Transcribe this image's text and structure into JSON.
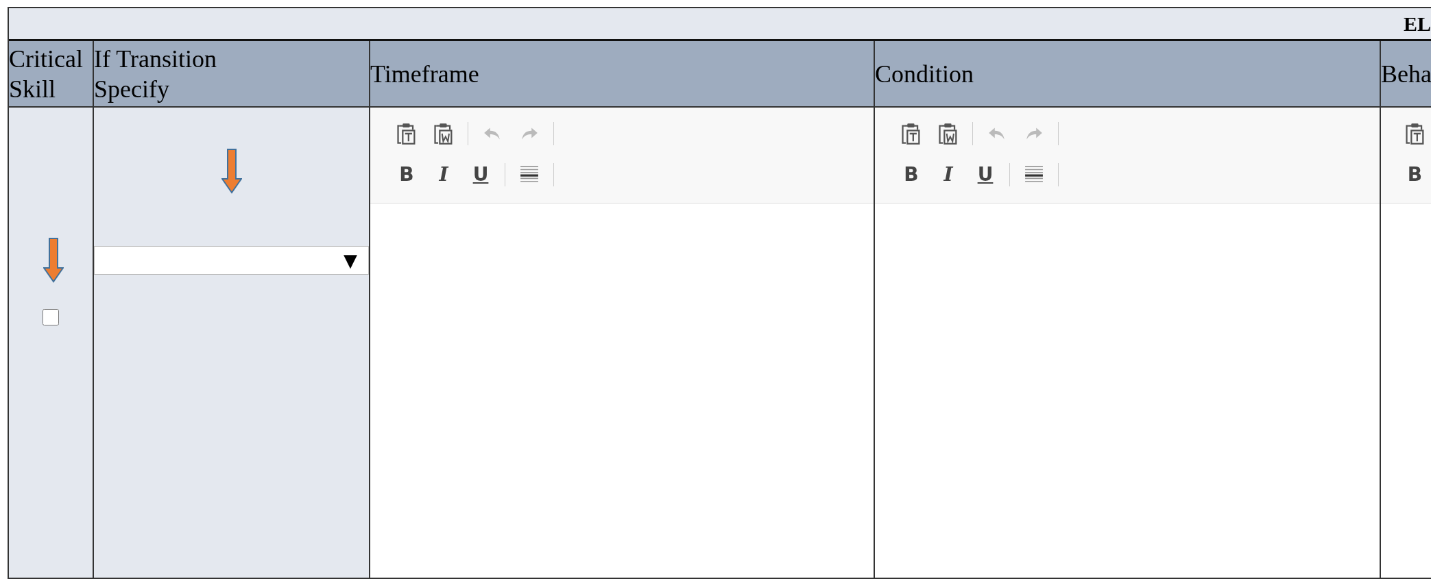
{
  "title": "EL",
  "headers": [
    "Critical Skill",
    "If Transition\nSpecify",
    "Timeframe",
    "Condition",
    "Beha"
  ],
  "critical_skill": {
    "checked": false
  },
  "transition_select": {
    "caret": "▼"
  },
  "editors": [
    {
      "rows": [
        [
          {
            "kind": "paste_text"
          },
          {
            "kind": "paste_word"
          },
          {
            "kind": "separator"
          },
          {
            "kind": "undo",
            "disabled": true
          },
          {
            "kind": "redo",
            "disabled": true
          },
          {
            "kind": "separator"
          }
        ],
        [
          {
            "kind": "bold",
            "label": "B"
          },
          {
            "kind": "italic",
            "label": "I"
          },
          {
            "kind": "underline",
            "label": "U"
          },
          {
            "kind": "separator"
          },
          {
            "kind": "rule"
          },
          {
            "kind": "separator"
          }
        ]
      ]
    },
    {
      "rows": [
        [
          {
            "kind": "paste_text"
          },
          {
            "kind": "paste_word"
          },
          {
            "kind": "separator"
          },
          {
            "kind": "undo",
            "disabled": true
          },
          {
            "kind": "redo",
            "disabled": true
          },
          {
            "kind": "separator"
          }
        ],
        [
          {
            "kind": "bold",
            "label": "B"
          },
          {
            "kind": "italic",
            "label": "I"
          },
          {
            "kind": "underline",
            "label": "U"
          },
          {
            "kind": "separator"
          },
          {
            "kind": "rule"
          },
          {
            "kind": "separator"
          }
        ]
      ]
    },
    {
      "rows": [
        [
          {
            "kind": "paste_text"
          }
        ],
        [
          {
            "kind": "bold",
            "label": "B"
          }
        ]
      ]
    }
  ]
}
